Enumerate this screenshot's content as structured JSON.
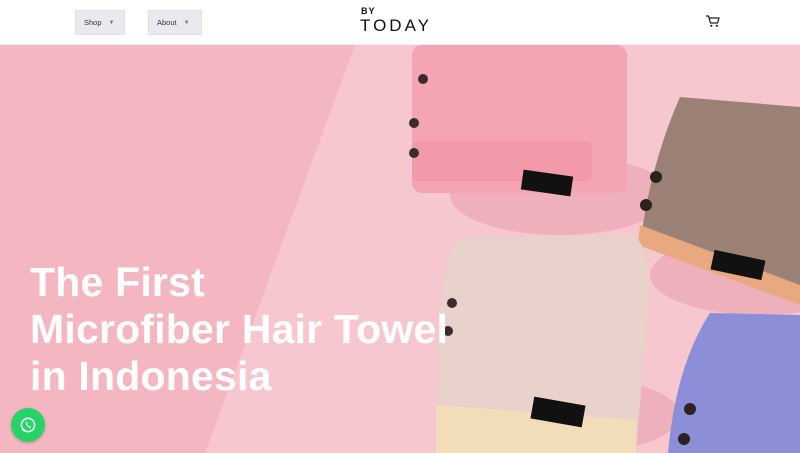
{
  "header": {
    "nav": [
      {
        "label": "Shop"
      },
      {
        "label": "About"
      }
    ],
    "logo": {
      "top": "BY",
      "word": "TODAY"
    },
    "cart_icon": "shopping-cart-icon"
  },
  "hero": {
    "headline": [
      "The First",
      "Microfiber Hair Towel",
      "in Indonesia"
    ],
    "towel_tag": "HANDUK",
    "colors": {
      "background": "#f4b6c0",
      "light_panel": "#f7c3cc",
      "pink_towel": "#f5a4b3",
      "brown_towel": "#9b8175",
      "beige_towel": "#e9d2cb",
      "lilac_towel": "#8c8fd8"
    }
  },
  "whatsapp": {
    "icon": "whatsapp-icon"
  }
}
